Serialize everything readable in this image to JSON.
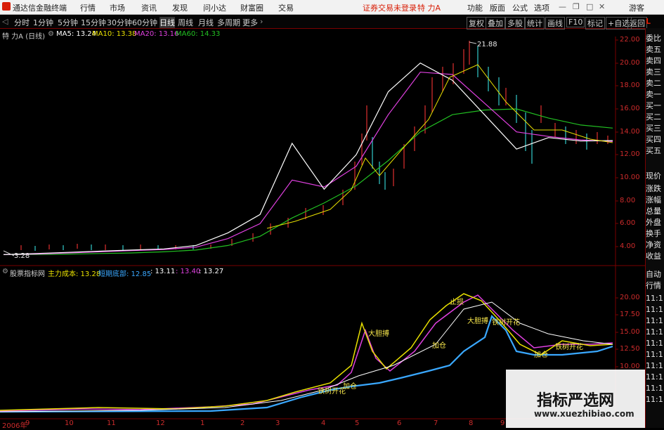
{
  "app": {
    "title": "通达信金融终端",
    "status": "证券交易未登录",
    "stock": "特 力A"
  },
  "menu": {
    "left": [
      "行情",
      "市场",
      "资讯",
      "发现",
      "问小达",
      "财富圈",
      "交易"
    ],
    "right": [
      "功能",
      "版面",
      "公式",
      "选项"
    ],
    "user": "游客"
  },
  "periods": [
    "分时",
    "1分钟",
    "5分钟",
    "15分钟",
    "30分钟",
    "60分钟",
    "日线",
    "周线",
    "月线",
    "多周期",
    "更多"
  ],
  "active_period": "日线",
  "toolbar": [
    "复权",
    "叠加",
    "多股",
    "统计",
    "画线",
    "F10",
    "标记",
    "+自选",
    "返回"
  ],
  "price_legend": {
    "name": "特 力A (日线)",
    "ma5": "MA5: 13.24",
    "ma10": "MA10: 13.38",
    "ma20": "MA20: 13.16",
    "ma60": "MA60: 14.33"
  },
  "indicator_legend": {
    "name": "股票指标网",
    "cost": "主力成本: 13.28",
    "short_bottom": "短期底部: 12.85",
    "v3": ": 13.11",
    "v4": ": 13.40",
    "v5": ": 13.27"
  },
  "annotations": {
    "high_price": "21.88",
    "low_price": "3.28",
    "signal_big": "大胆搏",
    "signal_add": "加仓",
    "signal_stop": "止损",
    "signal_bottom": "铁树开花"
  },
  "yaxis_price": [
    "22.00",
    "20.00",
    "18.00",
    "16.00",
    "14.00",
    "12.00",
    "10.00",
    "8.00",
    "6.00",
    "4.00"
  ],
  "yaxis_indicator": [
    "20.00",
    "17.50",
    "15.00",
    "12.50",
    "10.00"
  ],
  "xaxis": [
    "2006年",
    "9",
    "10",
    "11",
    "12",
    "1",
    "2",
    "3",
    "4",
    "5",
    "6",
    "7",
    "8",
    "9"
  ],
  "right_panel": {
    "letter": "L",
    "items": [
      "委比",
      "卖五",
      "卖四",
      "卖三",
      "卖二",
      "卖一",
      "买一",
      "买二",
      "买三",
      "买四",
      "买五",
      "现价",
      "涨跌",
      "涨幅",
      "总量",
      "外盘",
      "换手",
      "净资",
      "收益"
    ],
    "lower": [
      "自动",
      "行情",
      "11:1",
      "11:1",
      "11:1",
      "11:1",
      "11:1",
      "11:1",
      "11:1",
      "11:1",
      "11:1",
      "11:1"
    ]
  },
  "watermark": {
    "title": "指标严选网",
    "url": "www.xuezhibiao.com"
  },
  "colors": {
    "ma5": "#ffffff",
    "ma10": "#e8e000",
    "ma20": "#e040e0",
    "ma60": "#22c022",
    "up": "#e03030",
    "down": "#33cccc",
    "cost_line": "#3aa8ff"
  },
  "chart_data": {
    "type": "line",
    "ylim": [
      3,
      22.5
    ],
    "series": [
      {
        "name": "MA5",
        "values": [
          3.3,
          3.4,
          3.5,
          3.6,
          3.7,
          3.8,
          4.1,
          5.2,
          6.8,
          13.0,
          9.0,
          12.0,
          17.5,
          20.0,
          18.5,
          15.5,
          12.5,
          13.5,
          13.2,
          13.24
        ]
      },
      {
        "name": "MA20",
        "values": [
          3.3,
          3.35,
          3.45,
          3.55,
          3.65,
          3.75,
          3.95,
          4.7,
          6.0,
          9.8,
          9.2,
          11.0,
          15.5,
          19.2,
          19.0,
          16.5,
          14.0,
          13.6,
          13.3,
          13.16
        ]
      },
      {
        "name": "MA60",
        "values": [
          3.3,
          3.3,
          3.35,
          3.4,
          3.45,
          3.55,
          3.7,
          4.1,
          4.9,
          6.5,
          7.8,
          9.3,
          11.5,
          14.0,
          15.5,
          15.9,
          16.0,
          15.2,
          14.6,
          14.33
        ]
      }
    ]
  }
}
